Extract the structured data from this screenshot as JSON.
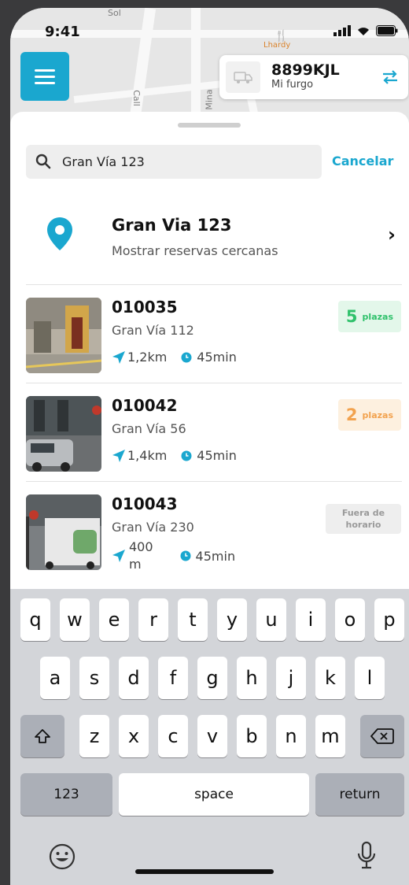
{
  "status_bar": {
    "time": "9:41"
  },
  "map": {
    "street_label_top": "Sol",
    "street_label_1": "Call",
    "street_label_2": "Mina",
    "poi_label": "Lhardy"
  },
  "vehicle": {
    "plate": "8899KJL",
    "nickname": "Mi furgo"
  },
  "search": {
    "value": "Gran Vía 123",
    "cancel_label": "Cancelar"
  },
  "nearby": {
    "title": "Gran Via 123",
    "subtitle": "Mostrar reservas cercanas"
  },
  "results": [
    {
      "id": "010035",
      "address": "Gran Vía 112",
      "distance": "1,2km",
      "time": "45min",
      "badge_number": "5",
      "badge_label": "plazas"
    },
    {
      "id": "010042",
      "address": "Gran Vía 56",
      "distance": "1,4km",
      "time": "45min",
      "badge_number": "2",
      "badge_label": "plazas"
    },
    {
      "id": "010043",
      "address": "Gran Vía 230",
      "distance_line1": "400",
      "distance_line2": "m",
      "time": "45min",
      "badge_label": "Fuera de horario"
    }
  ],
  "keyboard": {
    "row1": [
      "q",
      "w",
      "e",
      "r",
      "t",
      "y",
      "u",
      "i",
      "o",
      "p"
    ],
    "row2": [
      "a",
      "s",
      "d",
      "f",
      "g",
      "h",
      "j",
      "k",
      "l"
    ],
    "row3": [
      "z",
      "x",
      "c",
      "v",
      "b",
      "n",
      "m"
    ],
    "numbers_label": "123",
    "space_label": "space",
    "return_label": "return"
  },
  "colors": {
    "accent": "#1aa7cf",
    "green": "#2fc16b",
    "orange": "#f2a24e",
    "gray": "#9a9a9a"
  },
  "icons": [
    "menu-icon",
    "van-icon",
    "swap-icon",
    "search-icon",
    "location-pin-icon",
    "chevron-right-icon",
    "navigation-arrow-icon",
    "clock-icon",
    "shift-icon",
    "backspace-icon",
    "emoji-icon",
    "microphone-icon"
  ]
}
